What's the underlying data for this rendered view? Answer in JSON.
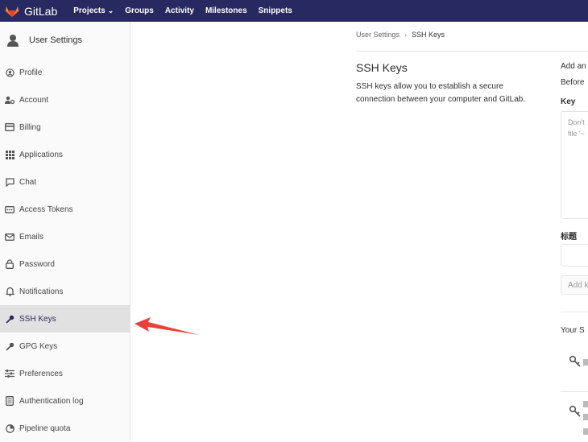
{
  "topbar": {
    "brand": "GitLab",
    "brand_color": "#fc6d26",
    "bg_color": "#292961",
    "nav": [
      {
        "label": "Projects",
        "has_caret": true
      },
      {
        "label": "Groups",
        "has_caret": false
      },
      {
        "label": "Activity",
        "has_caret": false
      },
      {
        "label": "Milestones",
        "has_caret": false
      },
      {
        "label": "Snippets",
        "has_caret": false
      }
    ]
  },
  "sidebar": {
    "header": "User Settings",
    "items": [
      {
        "label": "Profile",
        "icon": "profile-icon"
      },
      {
        "label": "Account",
        "icon": "account-icon"
      },
      {
        "label": "Billing",
        "icon": "billing-icon"
      },
      {
        "label": "Applications",
        "icon": "applications-icon"
      },
      {
        "label": "Chat",
        "icon": "chat-icon"
      },
      {
        "label": "Access Tokens",
        "icon": "access-tokens-icon"
      },
      {
        "label": "Emails",
        "icon": "email-icon"
      },
      {
        "label": "Password",
        "icon": "lock-icon"
      },
      {
        "label": "Notifications",
        "icon": "bell-icon"
      },
      {
        "label": "SSH Keys",
        "icon": "key-icon",
        "active": true
      },
      {
        "label": "GPG Keys",
        "icon": "key-icon"
      },
      {
        "label": "Preferences",
        "icon": "preferences-icon"
      },
      {
        "label": "Authentication log",
        "icon": "log-icon"
      },
      {
        "label": "Pipeline quota",
        "icon": "pipeline-icon"
      }
    ]
  },
  "breadcrumb": {
    "parent": "User Settings",
    "current": "SSH Keys"
  },
  "main": {
    "title": "SSH Keys",
    "description": "SSH keys allow you to establish a secure connection between your computer and GitLab."
  },
  "form": {
    "heading": "Add an",
    "before_text": "Before",
    "key_label": "Key",
    "key_placeholder": "Don't\nfile '~",
    "title_label": "标题",
    "add_button": "Add k",
    "your_keys_heading": "Your S"
  },
  "annotation": {
    "arrow_color": "#e8403a"
  }
}
